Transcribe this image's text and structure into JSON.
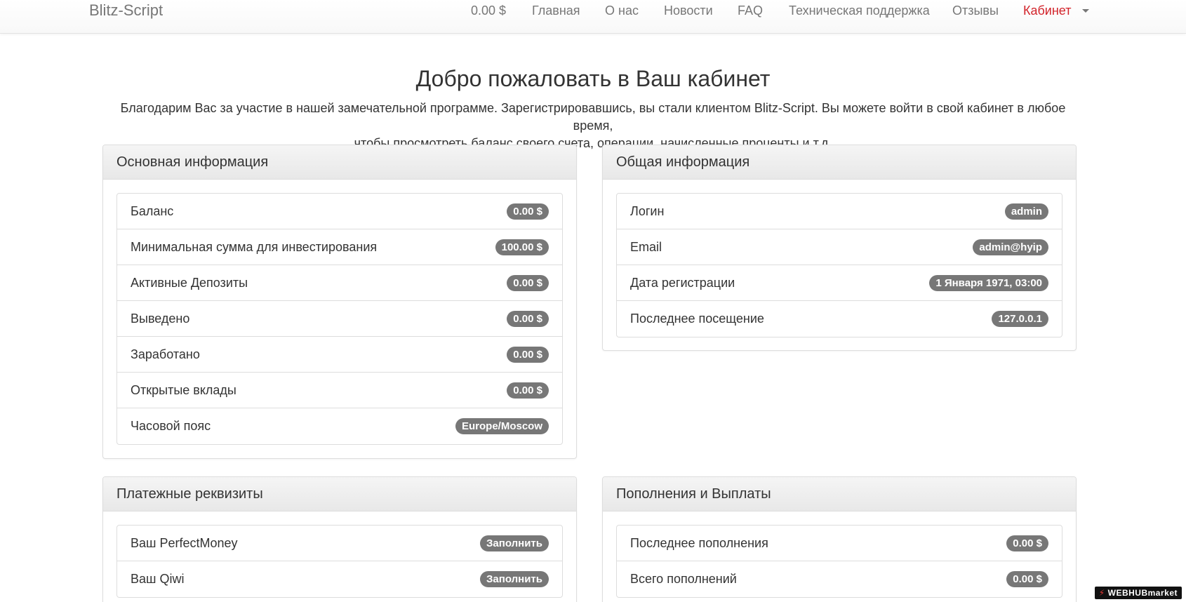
{
  "navbar": {
    "brand": "Blitz-Script",
    "items": [
      {
        "label": "0.00 $"
      },
      {
        "label": "Главная"
      },
      {
        "label": "О нас"
      },
      {
        "label": "Новости"
      },
      {
        "label": "FAQ"
      },
      {
        "label": "Техническая поддержка"
      },
      {
        "label": "Отзывы"
      },
      {
        "label": "Кабинет"
      }
    ],
    "active_color": "#d2232a"
  },
  "main": {
    "title": "Добро пожаловать в Ваш кабинет",
    "intro_line1": "Благодарим Вас за участие в нашей замечательной программе. Зарегистрировавшись, вы стали клиентом Blitz-Script. Вы можете войти в свой кабинет в любое время,",
    "intro_line2": "чтобы просмотреть баланс своего счета, операции, начисленные проценты и т.д."
  },
  "panels": {
    "basic": {
      "heading": "Основная информация",
      "rows": [
        {
          "label": "Баланс",
          "value": "0.00 $"
        },
        {
          "label": "Минимальная сумма для инвестирования",
          "value": "100.00 $"
        },
        {
          "label": "Активные Депозиты",
          "value": "0.00 $"
        },
        {
          "label": "Выведено",
          "value": "0.00 $"
        },
        {
          "label": "Заработано",
          "value": "0.00 $"
        },
        {
          "label": "Открытые вклады",
          "value": "0.00 $"
        },
        {
          "label": "Часовой пояс",
          "value": "Europe/Moscow"
        }
      ]
    },
    "general": {
      "heading": "Общая информация",
      "rows": [
        {
          "label": "Логин",
          "value": "admin"
        },
        {
          "label": "Email",
          "value": "admin@hyip"
        },
        {
          "label": "Дата регистрации",
          "value": "1 Января 1971, 03:00"
        },
        {
          "label": "Последнее посещение",
          "value": "127.0.0.1"
        }
      ]
    },
    "payment": {
      "heading": "Платежные реквизиты",
      "rows": [
        {
          "label": "Ваш PerfectMoney",
          "value": "Заполнить"
        },
        {
          "label": "Ваш Qiwi",
          "value": "Заполнить"
        }
      ]
    },
    "deposits": {
      "heading": "Пополнения и Выплаты",
      "rows": [
        {
          "label": "Последнее пополнения",
          "value": "0.00 $"
        },
        {
          "label": "Всего пополнений",
          "value": "0.00 $"
        }
      ]
    }
  },
  "watermark": "WEBHUBmarket",
  "colors": {
    "badge": "#777777",
    "accent": "#d2232a"
  }
}
